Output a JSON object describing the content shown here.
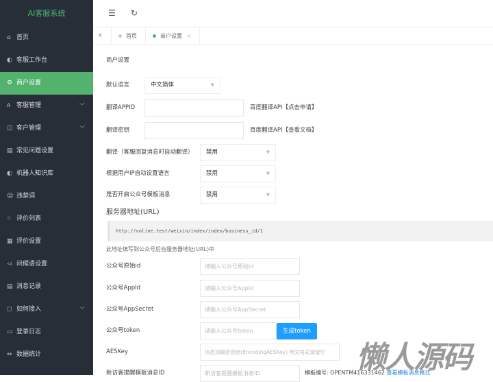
{
  "app_title": "AI客服系统",
  "sidebar": {
    "items": [
      {
        "label": "首页",
        "icon": "⌂"
      },
      {
        "label": "客服工作台",
        "icon": "◐"
      },
      {
        "label": "商户设置",
        "icon": "⚙",
        "active": true
      },
      {
        "label": "客服管理",
        "icon": "ጰ",
        "chevron": true
      },
      {
        "label": "客户管理",
        "icon": "◫",
        "chevron": true
      },
      {
        "label": "常见问题设置",
        "icon": "▤"
      },
      {
        "label": "机器人知识库",
        "icon": "◐"
      },
      {
        "label": "违禁词",
        "icon": "☺"
      },
      {
        "label": "评价列表",
        "icon": "☝"
      },
      {
        "label": "评价设置",
        "icon": "▦"
      },
      {
        "label": "问候语设置",
        "icon": "◅"
      },
      {
        "label": "消息记录",
        "icon": "▤"
      },
      {
        "label": "如何接入",
        "icon": "◻",
        "chevron": true
      },
      {
        "label": "登录日志",
        "icon": "▭"
      },
      {
        "label": "数据统计",
        "icon": "⇔"
      }
    ]
  },
  "header": {
    "menu_icon": "☰",
    "refresh_icon": "↻"
  },
  "tabs": {
    "back": "‹",
    "items": [
      {
        "label": "首页"
      },
      {
        "label": "商户设置",
        "close": "×"
      }
    ]
  },
  "card_title": "商户设置",
  "form": {
    "default_lang": {
      "label": "默认语言",
      "value": "中文简体"
    },
    "appid": {
      "label": "翻译APPID",
      "value": "",
      "aside": "百度翻译API【点击申请】"
    },
    "secret": {
      "label": "翻译密钥",
      "value": "",
      "aside": "百度翻译API【查看文档】"
    },
    "auto_translate": {
      "label": "翻译（客服回复消息时自动翻译）",
      "value": "禁用"
    },
    "ip_lang": {
      "label": "根据用户IP自动设置语言",
      "value": "禁用"
    },
    "tpl_msg": {
      "label": "是否开启公众号模板消息",
      "value": "禁用"
    },
    "server_url_label": "服务器地址(URL)",
    "server_url": "http://voline.test/weixin/index/index/business_id/1",
    "server_url_note": "此地址填写到公众号后台服务器地址(URL)中",
    "orig_id": {
      "label": "公众号原始id",
      "placeholder": "请输入公众号原始id"
    },
    "app_id": {
      "label": "公众号AppId",
      "placeholder": "请输入公众号AppId"
    },
    "app_secret": {
      "label": "公众号AppSecret",
      "placeholder": "请输入公众号AppSecret"
    },
    "token": {
      "label": "公众号token",
      "placeholder": "请输入公众号token",
      "button": "生成token"
    },
    "aeskey": {
      "label": "AESKey",
      "placeholder": "消息加解密密钥(EncodingAESKey) 明文格式请留空"
    },
    "visitor_tpl": {
      "label": "新访客提醒模板消息ID",
      "placeholder": "新访客提醒模板消息ID",
      "aside": "模板编号: OPENTM416331462",
      "link": "查看模板消息格式"
    }
  },
  "watermark": "懒人源码"
}
